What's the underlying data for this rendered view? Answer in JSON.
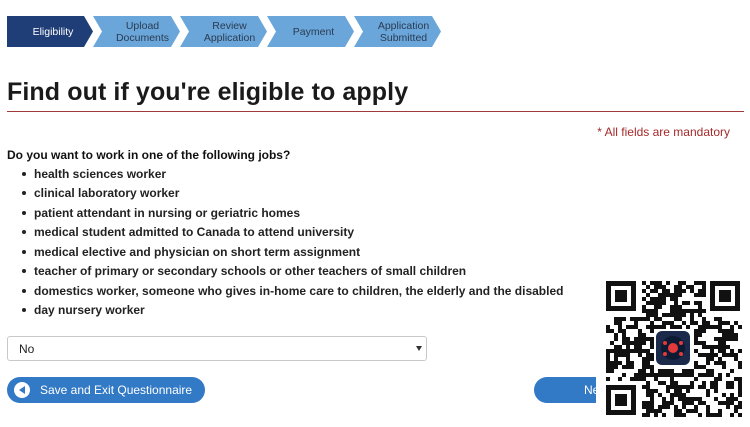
{
  "steps": [
    {
      "lines": [
        "Eligibility"
      ],
      "active": true
    },
    {
      "lines": [
        "Upload",
        "Documents"
      ],
      "active": false
    },
    {
      "lines": [
        "Review",
        "Application"
      ],
      "active": false
    },
    {
      "lines": [
        "Payment"
      ],
      "active": false
    },
    {
      "lines": [
        "Application",
        "Submitted"
      ],
      "active": false
    }
  ],
  "page_title": "Find out if you're eligible to apply",
  "mandatory_note": "* All fields are mandatory",
  "question": "Do you want to work in one of the following jobs?",
  "jobs": [
    "health sciences worker",
    "clinical laboratory worker",
    "patient attendant in nursing or geriatric homes",
    "medical student admitted to Canada to attend university",
    "medical elective and physician on short term assignment",
    "teacher of primary or secondary schools or other teachers of small children",
    "domestics worker, someone who gives in-home care to children, the elderly and the disabled",
    "day nursery worker"
  ],
  "answer_select": {
    "value": "No"
  },
  "buttons": {
    "save_exit": "Save and Exit Questionnaire",
    "next": "Ne"
  },
  "colors": {
    "step_active": "#1f3e78",
    "step_pending": "#6aa6da",
    "button": "#3279c6",
    "rule": "#a03a3a",
    "mandatory": "#a52a2a"
  },
  "icons": {
    "back": "back-arrow-circle-icon",
    "select_caret": "caret-down-icon",
    "qr": "qr-code"
  }
}
